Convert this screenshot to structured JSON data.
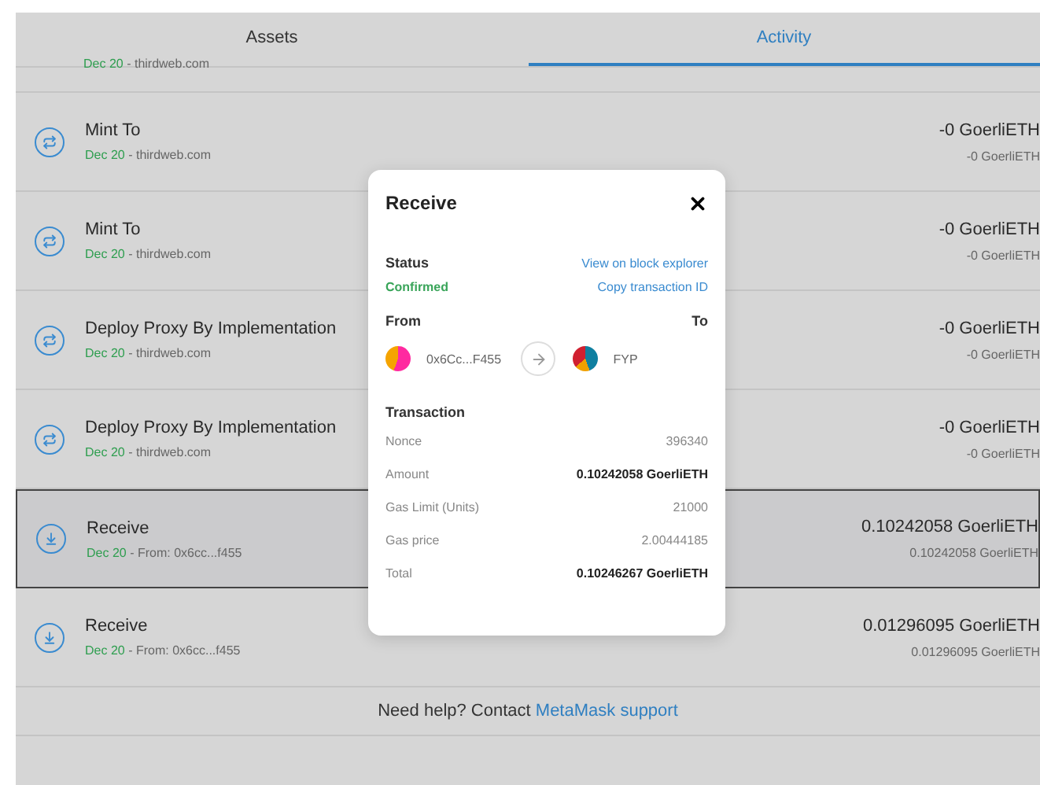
{
  "tabs": [
    {
      "label": "Assets",
      "selected": false
    },
    {
      "label": "Activity",
      "selected": true
    }
  ],
  "partial_row": {
    "date": "Dec 20",
    "detail": " - thirdweb.com"
  },
  "activity": [
    {
      "kind": "swap",
      "title": "Mint To",
      "date": "Dec 20",
      "detail": " - thirdweb.com",
      "amount": "-0 GoerliETH",
      "sub_amount": "-0 GoerliETH",
      "selected": false
    },
    {
      "kind": "swap",
      "title": "Mint To",
      "date": "Dec 20",
      "detail": " - thirdweb.com",
      "amount": "-0 GoerliETH",
      "sub_amount": "-0 GoerliETH",
      "selected": false
    },
    {
      "kind": "swap",
      "title": "Deploy Proxy By Implementation",
      "date": "Dec 20",
      "detail": " - thirdweb.com",
      "amount": "-0 GoerliETH",
      "sub_amount": "-0 GoerliETH",
      "selected": false
    },
    {
      "kind": "swap",
      "title": "Deploy Proxy By Implementation",
      "date": "Dec 20",
      "detail": " - thirdweb.com",
      "amount": "-0 GoerliETH",
      "sub_amount": "-0 GoerliETH",
      "selected": false
    },
    {
      "kind": "receive",
      "title": "Receive",
      "date": "Dec 20",
      "detail": " - From: 0x6cc...f455",
      "amount": "0.10242058 GoerliETH",
      "sub_amount": "0.10242058 GoerliETH",
      "selected": true
    },
    {
      "kind": "receive",
      "title": "Receive",
      "date": "Dec 20",
      "detail": " - From: 0x6cc...f455",
      "amount": "0.01296095 GoerliETH",
      "sub_amount": "0.01296095 GoerliETH",
      "selected": false
    }
  ],
  "footer": {
    "text": "Need help? Contact ",
    "link": "MetaMask support"
  },
  "modal": {
    "title": "Receive",
    "status_label": "Status",
    "status": "Confirmed",
    "explorer_link": "View on block explorer",
    "copy_link": "Copy transaction ID",
    "from_label": "From",
    "to_label": "To",
    "from_address": "0x6Cc...F455",
    "to_name": "FYP",
    "transaction_heading": "Transaction",
    "details": [
      {
        "label": "Nonce",
        "value": "396340",
        "bold": false
      },
      {
        "label": "Amount",
        "value": "0.10242058 GoerliETH",
        "bold": true
      },
      {
        "label": "Gas Limit (Units)",
        "value": "21000",
        "bold": false
      },
      {
        "label": "Gas price",
        "value": "2.00444185",
        "bold": false
      },
      {
        "label": "Total",
        "value": "0.10246267 GoerliETH",
        "bold": true
      }
    ]
  }
}
